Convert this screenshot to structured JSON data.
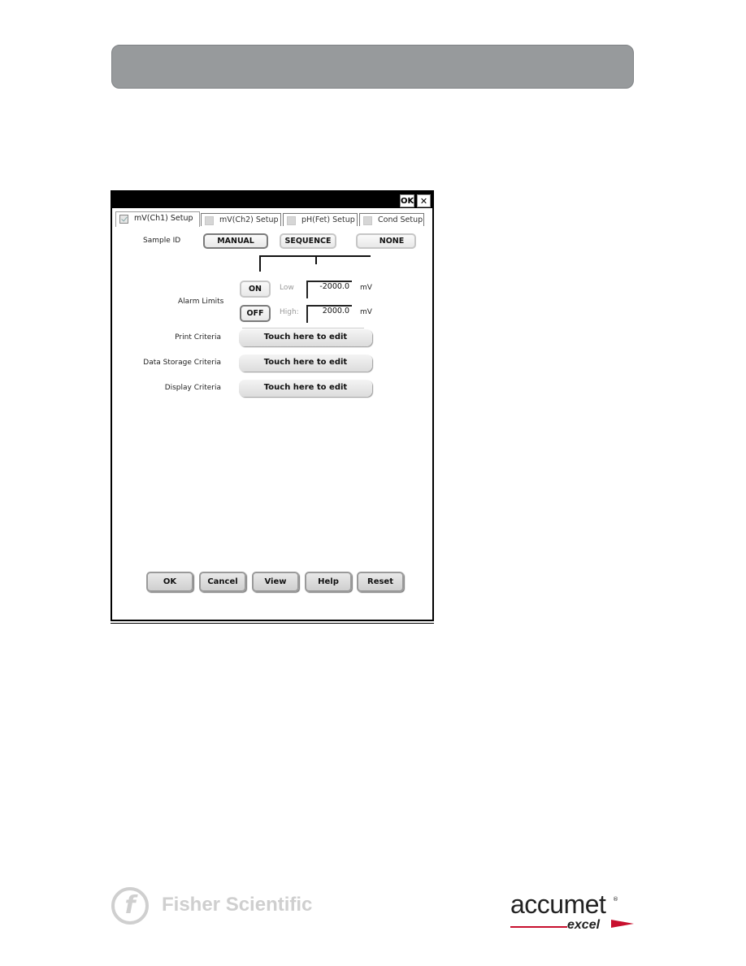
{
  "window": {
    "titlebar_ok": "OK",
    "titlebar_close": "✕"
  },
  "tabs": [
    {
      "label": "mV(Ch1) Setup",
      "checked": true,
      "active": true
    },
    {
      "label": "mV(Ch2) Setup",
      "checked": false,
      "active": false
    },
    {
      "label": "pH(Fet) Setup",
      "checked": false,
      "active": false
    },
    {
      "label": "Cond Setup",
      "checked": false,
      "active": false
    }
  ],
  "sample_id": {
    "label": "Sample ID",
    "options": [
      "MANUAL",
      "SEQUENCE",
      "NONE"
    ],
    "selected": "MANUAL"
  },
  "alarm_limits": {
    "label": "Alarm Limits",
    "on_label": "ON",
    "off_label": "OFF",
    "selected": "OFF",
    "low_label": "Low",
    "low_value": "-2000.0",
    "high_label": "High:",
    "high_value": "2000.0",
    "unit": "mV"
  },
  "criteria": [
    {
      "label": "Print Criteria",
      "button": "Touch here to edit"
    },
    {
      "label": "Data Storage Criteria",
      "button": "Touch here to edit"
    },
    {
      "label": "Display Criteria",
      "button": "Touch here to edit"
    }
  ],
  "bottom_buttons": [
    "OK",
    "Cancel",
    "View",
    "Help",
    "Reset"
  ],
  "footer": {
    "fisher_logo_letter": "f",
    "fisher_text": "Fisher Scientific",
    "accumet_word": "accumet",
    "accumet_tm": "®",
    "accumet_sub": "excel"
  }
}
